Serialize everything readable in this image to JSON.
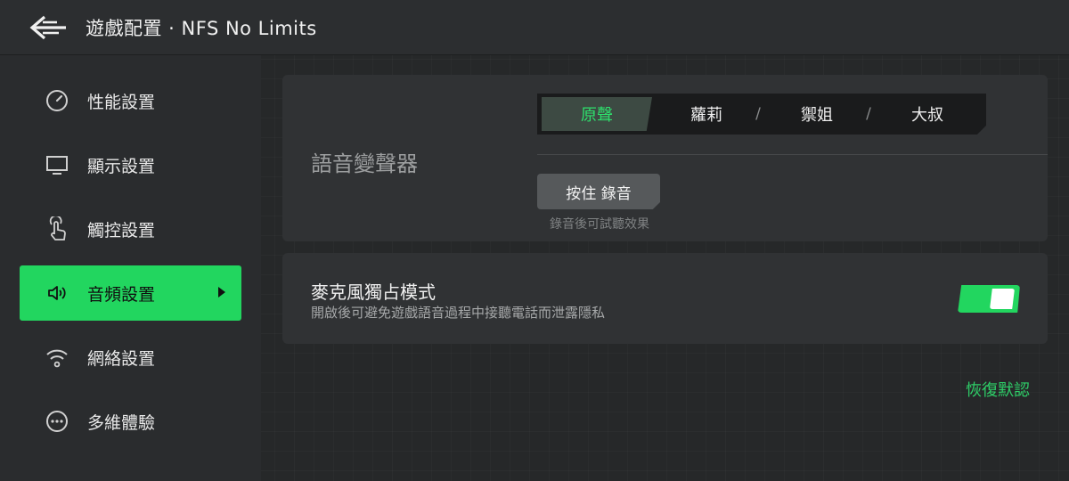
{
  "header": {
    "title": "遊戲配置 · NFS No Limits"
  },
  "sidebar": {
    "items": [
      {
        "label": "性能設置",
        "icon": "gauge-icon"
      },
      {
        "label": "顯示設置",
        "icon": "monitor-icon"
      },
      {
        "label": "觸控設置",
        "icon": "touch-icon"
      },
      {
        "label": "音頻設置",
        "icon": "speaker-icon",
        "active": true
      },
      {
        "label": "網絡設置",
        "icon": "wifi-icon"
      },
      {
        "label": "多維體驗",
        "icon": "more-icon"
      }
    ]
  },
  "voice_changer": {
    "label": "語音變聲器",
    "options": [
      "原聲",
      "蘿莉",
      "禦姐",
      "大叔"
    ],
    "separator": "/",
    "selected": "原聲",
    "record_button": "按住 錄音",
    "record_hint": "錄音後可試聽效果"
  },
  "mic_exclusive": {
    "title": "麥克風獨占模式",
    "description": "開啟後可避免遊戲語音過程中接聽電話而泄露隱私",
    "enabled": true
  },
  "reset_label": "恢復默認",
  "colors": {
    "accent": "#22d65f",
    "background": "#262829",
    "card": "#303234"
  }
}
